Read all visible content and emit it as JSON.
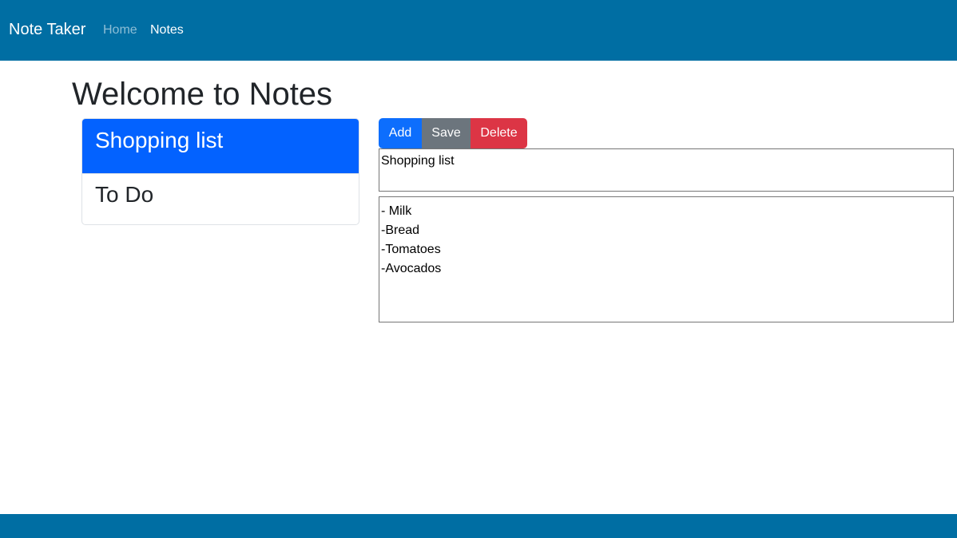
{
  "navbar": {
    "brand": "Note Taker",
    "links": [
      {
        "label": "Home",
        "active": false
      },
      {
        "label": "Notes",
        "active": true
      }
    ],
    "background_color": "#006ea3"
  },
  "main": {
    "title": "Welcome to Notes",
    "notes": [
      {
        "title": "Shopping list",
        "selected": true
      },
      {
        "title": "To Do",
        "selected": false
      }
    ],
    "toolbar": {
      "add_label": "Add",
      "save_label": "Save",
      "delete_label": "Delete"
    },
    "editor": {
      "title_value": "Shopping list",
      "body_lines": [
        "- Milk",
        "-Bread",
        "-Tomatoes",
        "-Avocados"
      ]
    },
    "colors": {
      "primary": "#0d6efd",
      "secondary": "#6c757d",
      "danger": "#dc3545",
      "selected_item": "#0362ff"
    }
  },
  "footer": {
    "background_color": "#006ea3"
  }
}
